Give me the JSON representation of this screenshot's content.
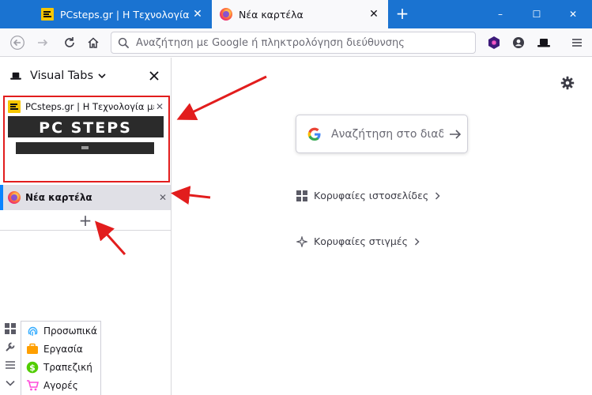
{
  "window": {
    "tabs": [
      {
        "title": "PCsteps.gr | Η Τεχνολογία με Απλά Λόγια",
        "favicon": "pcsteps-icon",
        "active": false
      },
      {
        "title": "Νέα καρτέλα",
        "favicon": "firefox-icon",
        "active": true
      }
    ],
    "controls": {
      "minimize": "–",
      "maximize": "☐",
      "close": "✕"
    },
    "accent": "#1a73d1"
  },
  "toolbar": {
    "url_placeholder": "Αναζήτηση με Google ή πληκτρολόγηση διεύθυνσης"
  },
  "sidebar": {
    "title": "Visual Tabs",
    "tabs": [
      {
        "title": "PCsteps.gr | Η Τεχνολογία με Απλά Λόγια",
        "thumbnail_text": "PC STEPS",
        "highlight": "#e21d1d"
      },
      {
        "title": "Νέα καρτέλα",
        "selected": true
      }
    ],
    "add_symbol": "+",
    "containers": [
      {
        "label": "Προσωπικά",
        "color": "#37adff",
        "icon": "fingerprint-icon"
      },
      {
        "label": "Εργασία",
        "color": "#ff9f00",
        "icon": "briefcase-icon"
      },
      {
        "label": "Τραπεζική",
        "color": "#51cd00",
        "icon": "dollar-icon"
      },
      {
        "label": "Αγορές",
        "color": "#ff4bda",
        "icon": "cart-icon"
      }
    ]
  },
  "newtab": {
    "search_placeholder": "Αναζήτηση στο διαδίκτυο",
    "sections": [
      {
        "label": "Κορυφαίες ιστοσελίδες",
        "icon": "grid-icon"
      },
      {
        "label": "Κορυφαίες στιγμές",
        "icon": "sparkle-icon"
      }
    ]
  }
}
